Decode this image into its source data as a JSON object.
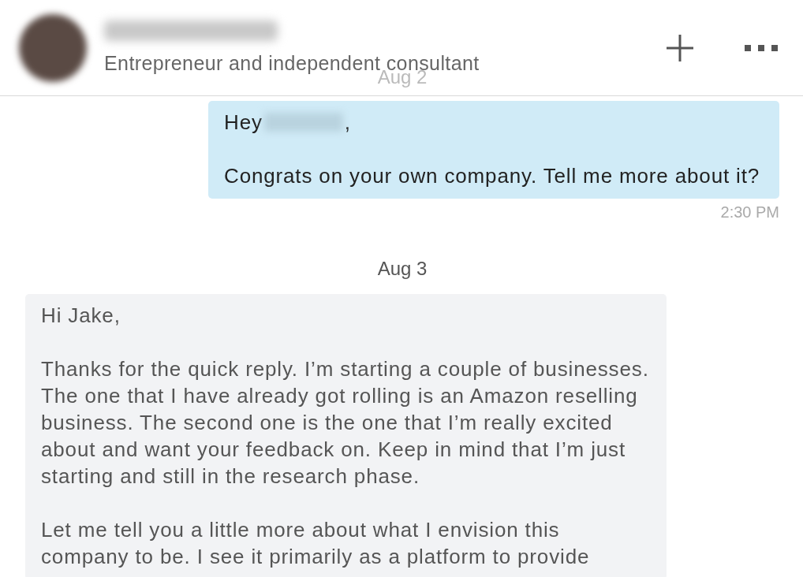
{
  "header": {
    "name_redacted": true,
    "subtitle": "Entrepreneur and independent consultant"
  },
  "conversation": [
    {
      "kind": "date",
      "text": "Aug 2"
    },
    {
      "kind": "sent",
      "greeting": {
        "text": "Hey",
        "name_redacted": true,
        "punctuation": ","
      },
      "paragraphs": [
        "Congrats on your own company. Tell me more about it?"
      ],
      "time": "2:30 PM"
    },
    {
      "kind": "date",
      "text": "Aug 3"
    },
    {
      "kind": "received",
      "paragraphs": [
        "Hi Jake,",
        "Thanks for the quick reply. I’m starting a couple of businesses. The one that I have already got rolling is an Amazon reselling business. The second one is the one that I’m really excited about and want your feedback on. Keep in mind that I’m just starting and still in the research phase.",
        "Let me tell you a little more about what I envision this company to be. I see it primarily as a platform to provide"
      ]
    }
  ]
}
